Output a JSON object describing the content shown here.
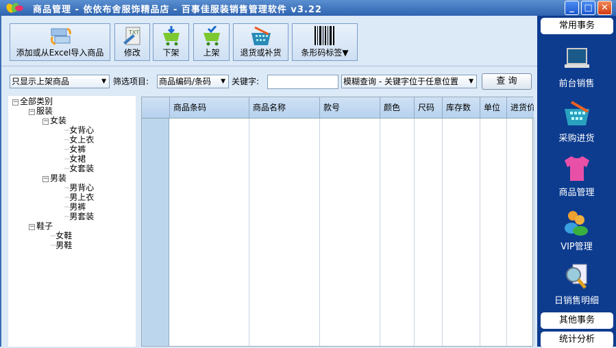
{
  "window": {
    "title": "商品管理 - 依依布舍服饰精品店 - 百事佳服装销售管理软件 v3.22",
    "minimize": "_",
    "maximize": "□",
    "close": "✕"
  },
  "toolbar": [
    {
      "label": "添加或从Excel导入商品",
      "icon": "excel-import-icon"
    },
    {
      "label": "修改",
      "icon": "edit-txt-icon"
    },
    {
      "label": "下架",
      "icon": "cart-down-icon"
    },
    {
      "label": "上架",
      "icon": "cart-check-icon"
    },
    {
      "label": "退货或补货",
      "icon": "basket-icon"
    },
    {
      "label": "条形码标签▼",
      "icon": "barcode-icon"
    }
  ],
  "filter": {
    "display_select": "只显示上架商品",
    "filter_label": "筛选项目:",
    "filter_select": "商品编码/条码",
    "keyword_label": "关键字:",
    "keyword_value": "",
    "mode_select": "模糊查询 - 关键字位于任意位置",
    "query_button": "查 询"
  },
  "tree": {
    "root": "全部类别",
    "nodes": [
      {
        "label": "服装",
        "level": 1,
        "expanded": true
      },
      {
        "label": "女装",
        "level": 2,
        "expanded": true
      },
      {
        "label": "女背心",
        "level": 3
      },
      {
        "label": "女上衣",
        "level": 3
      },
      {
        "label": "女裤",
        "level": 3
      },
      {
        "label": "女裙",
        "level": 3
      },
      {
        "label": "女套装",
        "level": 3
      },
      {
        "label": "男装",
        "level": 2,
        "expanded": true
      },
      {
        "label": "男背心",
        "level": 3
      },
      {
        "label": "男上衣",
        "level": 3
      },
      {
        "label": "男裤",
        "level": 3
      },
      {
        "label": "男套装",
        "level": 3
      },
      {
        "label": "鞋子",
        "level": 1,
        "expanded": true
      },
      {
        "label": "女鞋",
        "level": 2
      },
      {
        "label": "男鞋",
        "level": 2
      }
    ]
  },
  "grid": {
    "columns": [
      "商品条码",
      "商品名称",
      "款号",
      "颜色",
      "尺码",
      "库存数",
      "单位",
      "进货价"
    ],
    "rows": []
  },
  "sidebar": {
    "top_button": "常用事务",
    "items": [
      {
        "label": "前台销售",
        "icon": "laptop-icon"
      },
      {
        "label": "采购进货",
        "icon": "basket-icon"
      },
      {
        "label": "商品管理",
        "icon": "tshirt-icon"
      },
      {
        "label": "VIP管理",
        "icon": "users-icon"
      },
      {
        "label": "日销售明细",
        "icon": "magnifier-report-icon"
      }
    ],
    "bottom_buttons": [
      "其他事务",
      "统计分析"
    ]
  }
}
